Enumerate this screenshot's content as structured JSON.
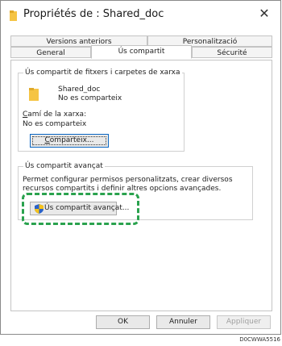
{
  "window": {
    "title": "Propriétés de : Shared_doc",
    "close_glyph": "✕"
  },
  "tabs_row1": [
    {
      "label": "Versions anteriors"
    },
    {
      "label": "Personalització"
    }
  ],
  "tabs_row2": [
    {
      "label": "General"
    },
    {
      "label": "Ús compartit",
      "active": true
    },
    {
      "label": "Sécurité"
    }
  ],
  "network_sharing": {
    "group_label": "Ús compartit de fitxers i carpetes de xarxa",
    "item_name": "Shared_doc",
    "item_status": "No es comparteix",
    "path_label_first": "C",
    "path_label_rest": "amí de la xarxa:",
    "path_value": "No es comparteix",
    "share_button_first": "C",
    "share_button_rest": "omparteix..."
  },
  "advanced_sharing": {
    "group_label": "Ús compartit avançat",
    "description_line1": "Permet configurar permisos personalitzats, crear diversos",
    "description_line2": "recursos compartits i definir altres opcions avançades.",
    "button_label": "Ús compartit avançat..."
  },
  "footer": {
    "ok_label": "OK",
    "cancel_label": "Annuler",
    "apply_label": "Appliquer"
  },
  "image_code": "D0CWWA5516",
  "colors": {
    "highlight": "#2aa24e",
    "folder": "#f5c444",
    "shield_blue": "#2a62c9",
    "shield_yellow": "#f5c21b"
  },
  "icons": {
    "title": "folder-icon",
    "item": "folder-icon",
    "advanced_button": "shield-icon",
    "close": "close-icon"
  }
}
